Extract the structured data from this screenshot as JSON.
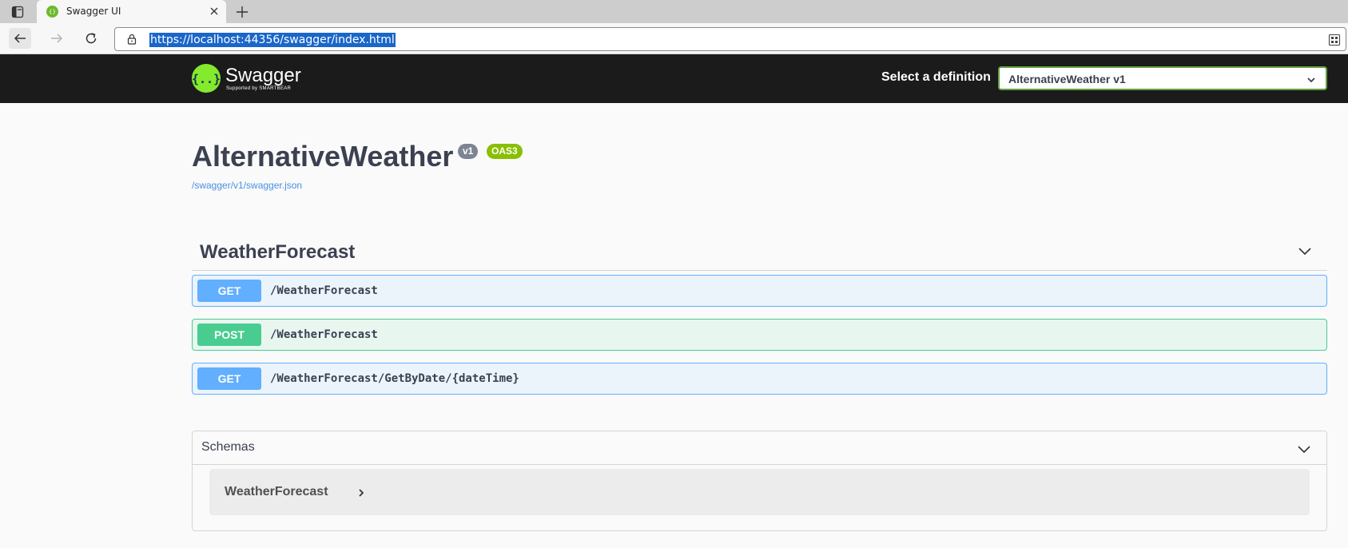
{
  "browser": {
    "tab_title": "Swagger UI",
    "url": "https://localhost:44356/swagger/index.html"
  },
  "topbar": {
    "logo_word": "Swagger",
    "logo_sub": "Supported by SMARTBEAR",
    "definition_label": "Select a definition",
    "definition_value": "AlternativeWeather v1"
  },
  "info": {
    "title": "AlternativeWeather",
    "version_badge": "v1",
    "oas_badge": "OAS3",
    "spec_link": "/swagger/v1/swagger.json"
  },
  "tag": {
    "name": "WeatherForecast",
    "operations": [
      {
        "method": "GET",
        "path": "/WeatherForecast"
      },
      {
        "method": "POST",
        "path": "/WeatherForecast"
      },
      {
        "method": "GET",
        "path": "/WeatherForecast/GetByDate/{dateTime}"
      }
    ]
  },
  "schemas": {
    "title": "Schemas",
    "models": [
      "WeatherForecast"
    ]
  },
  "colors": {
    "get": "#61affe",
    "post": "#49cc90",
    "topbar": "#1b1b1b",
    "logo": "#85ea2d"
  }
}
